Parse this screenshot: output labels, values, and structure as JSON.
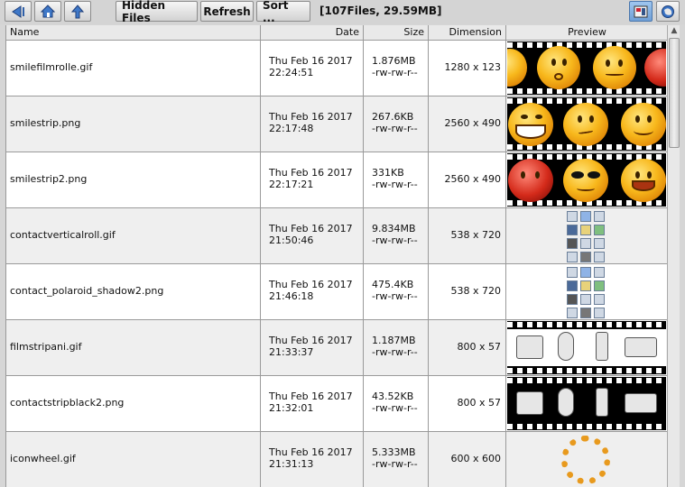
{
  "toolbar": {
    "back_icon": "back-arrow-icon",
    "home_icon": "home-icon",
    "up_icon": "up-arrow-icon",
    "hidden_files_label": "Hidden Files",
    "refresh_label": "Refresh",
    "sort_label": "Sort ...",
    "status": "[107Files, 29.59MB]",
    "view_icons_icon": "icon-view-icon",
    "view_world_icon": "globe-icon"
  },
  "columns": {
    "name": "Name",
    "date": "Date",
    "size": "Size",
    "dimension": "Dimension",
    "preview": "Preview"
  },
  "files": [
    {
      "name": "smilefilmrolle.gif",
      "date": "Thu Feb 16  2017",
      "time": "22:24:51",
      "size": "1.876MB",
      "perms": "-rw-rw-r--",
      "dimension": "1280 x 123",
      "preview": "film strip of smiley faces"
    },
    {
      "name": "smilestrip.png",
      "date": "Thu Feb 16  2017",
      "time": "22:17:48",
      "size": "267.6KB",
      "perms": "-rw-rw-r--",
      "dimension": "2560 x 490",
      "preview": "film strip of smiley faces"
    },
    {
      "name": "smilestrip2.png",
      "date": "Thu Feb 16  2017",
      "time": "22:17:21",
      "size": "331KB",
      "perms": "-rw-rw-r--",
      "dimension": "2560 x 490",
      "preview": "film strip of smiley faces"
    },
    {
      "name": "contactverticalroll.gif",
      "date": "Thu Feb 16  2017",
      "time": "21:50:46",
      "size": "9.834MB",
      "perms": "-rw-rw-r--",
      "dimension": "538 x 720",
      "preview": "grid of small icons"
    },
    {
      "name": "contact_polaroid_shadow2.png",
      "date": "Thu Feb 16  2017",
      "time": "21:46:18",
      "size": "475.4KB",
      "perms": "-rw-rw-r--",
      "dimension": "538 x 720",
      "preview": "grid of small icons"
    },
    {
      "name": "filmstripani.gif",
      "date": "Thu Feb 16  2017",
      "time": "21:33:37",
      "size": "1.187MB",
      "perms": "-rw-rw-r--",
      "dimension": "800 x 57",
      "preview": "film strip of devices"
    },
    {
      "name": "contactstripblack2.png",
      "date": "Thu Feb 16  2017",
      "time": "21:32:01",
      "size": "43.52KB",
      "perms": "-rw-rw-r--",
      "dimension": "800 x 57",
      "preview": "film strip of devices"
    },
    {
      "name": "iconwheel.gif",
      "date": "Thu Feb 16  2017",
      "time": "21:31:13",
      "size": "5.333MB",
      "perms": "-rw-rw-r--",
      "dimension": "600 x 600",
      "preview": "ring of smiley icons"
    }
  ],
  "colors": {
    "row_even": "#efefef",
    "row_odd": "#ffffff",
    "grid": "#9a9a9a",
    "active_toggle": "#6f9fd6"
  }
}
